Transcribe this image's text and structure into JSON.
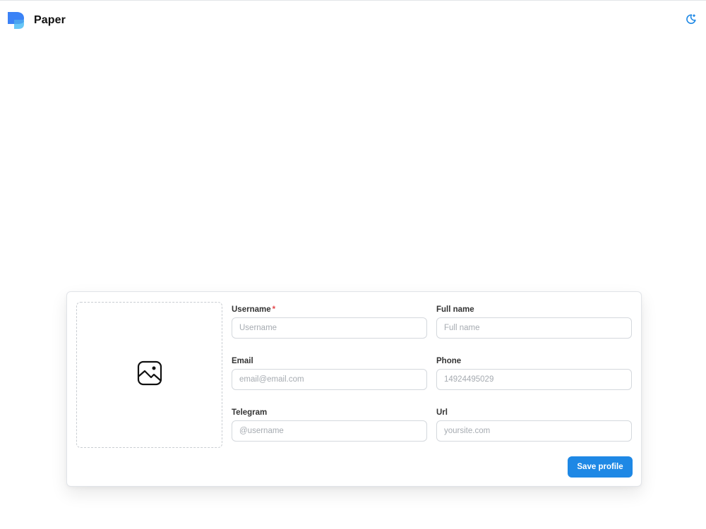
{
  "app": {
    "title": "Paper",
    "logo_icon": "paper-logo-icon",
    "theme_toggle_icon": "moon-icon",
    "accent_color": "#1e88e5"
  },
  "profile_form": {
    "avatar_icon": "image-icon",
    "fields": {
      "username": {
        "label": "Username",
        "required_mark": "*",
        "value": "",
        "placeholder": "Username"
      },
      "full_name": {
        "label": "Full name",
        "value": "",
        "placeholder": "Full name"
      },
      "email": {
        "label": "Email",
        "value": "",
        "placeholder": "email@email.com"
      },
      "phone": {
        "label": "Phone",
        "value": "",
        "placeholder": "14924495029"
      },
      "telegram": {
        "label": "Telegram",
        "value": "",
        "placeholder": "@username"
      },
      "url": {
        "label": "Url",
        "value": "",
        "placeholder": "yoursite.com"
      }
    },
    "save_label": "Save profile"
  }
}
